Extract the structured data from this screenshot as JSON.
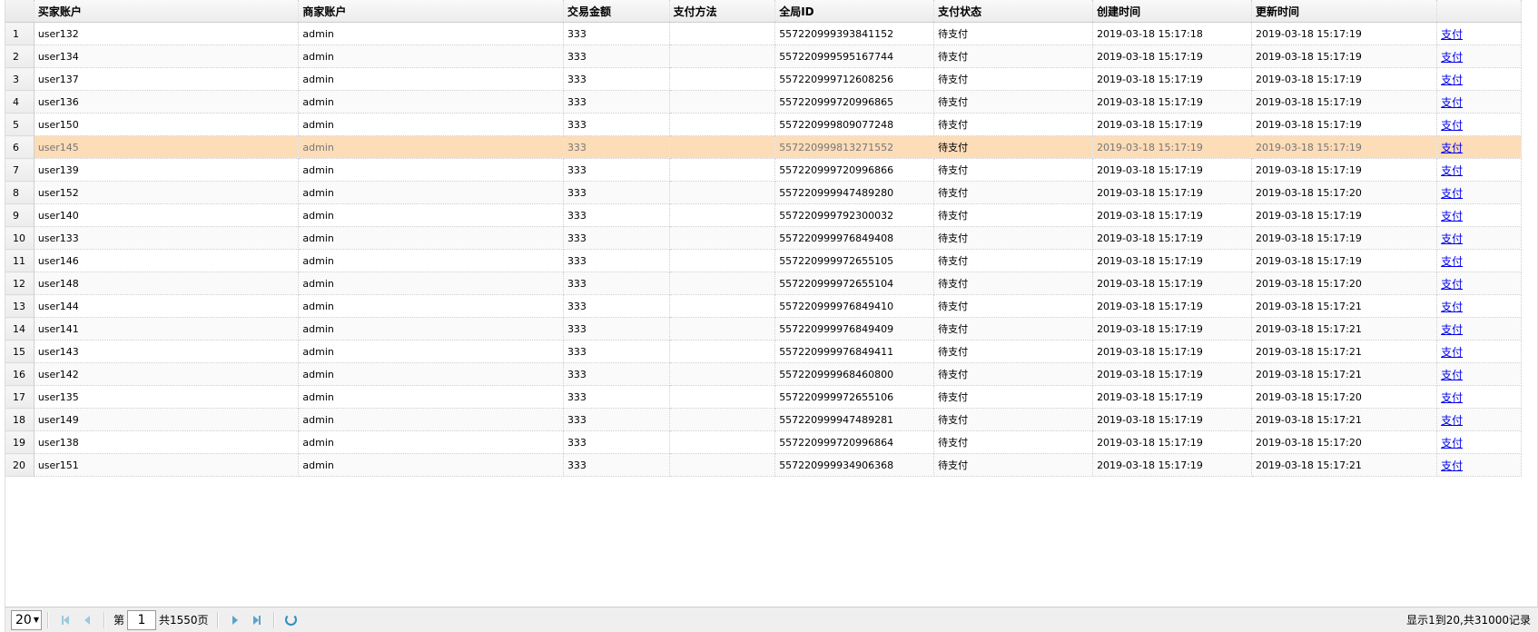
{
  "columns": [
    "买家账户",
    "商家账户",
    "交易金额",
    "支付方法",
    "全局ID",
    "支付状态",
    "创建时间",
    "更新时间",
    ""
  ],
  "rows": [
    {
      "n": "1",
      "buyer": "user132",
      "seller": "admin",
      "amount": "333",
      "method": "",
      "gid": "557220999393841152",
      "status": "待支付",
      "created": "2019-03-18  15:17:18",
      "updated": "2019-03-18  15:17:19",
      "action": "支付"
    },
    {
      "n": "2",
      "buyer": "user134",
      "seller": "admin",
      "amount": "333",
      "method": "",
      "gid": "557220999595167744",
      "status": "待支付",
      "created": "2019-03-18  15:17:19",
      "updated": "2019-03-18  15:17:19",
      "action": "支付"
    },
    {
      "n": "3",
      "buyer": "user137",
      "seller": "admin",
      "amount": "333",
      "method": "",
      "gid": "557220999712608256",
      "status": "待支付",
      "created": "2019-03-18  15:17:19",
      "updated": "2019-03-18  15:17:19",
      "action": "支付"
    },
    {
      "n": "4",
      "buyer": "user136",
      "seller": "admin",
      "amount": "333",
      "method": "",
      "gid": "557220999720996865",
      "status": "待支付",
      "created": "2019-03-18  15:17:19",
      "updated": "2019-03-18  15:17:19",
      "action": "支付"
    },
    {
      "n": "5",
      "buyer": "user150",
      "seller": "admin",
      "amount": "333",
      "method": "",
      "gid": "557220999809077248",
      "status": "待支付",
      "created": "2019-03-18  15:17:19",
      "updated": "2019-03-18  15:17:19",
      "action": "支付"
    },
    {
      "n": "6",
      "buyer": "user145",
      "seller": "admin",
      "amount": "333",
      "method": "",
      "gid": "557220999813271552",
      "status": "待支付",
      "created": "2019-03-18  15:17:19",
      "updated": "2019-03-18  15:17:19",
      "action": "支付",
      "selected": true
    },
    {
      "n": "7",
      "buyer": "user139",
      "seller": "admin",
      "amount": "333",
      "method": "",
      "gid": "557220999720996866",
      "status": "待支付",
      "created": "2019-03-18  15:17:19",
      "updated": "2019-03-18  15:17:19",
      "action": "支付"
    },
    {
      "n": "8",
      "buyer": "user152",
      "seller": "admin",
      "amount": "333",
      "method": "",
      "gid": "557220999947489280",
      "status": "待支付",
      "created": "2019-03-18  15:17:19",
      "updated": "2019-03-18  15:17:20",
      "action": "支付"
    },
    {
      "n": "9",
      "buyer": "user140",
      "seller": "admin",
      "amount": "333",
      "method": "",
      "gid": "557220999792300032",
      "status": "待支付",
      "created": "2019-03-18  15:17:19",
      "updated": "2019-03-18  15:17:19",
      "action": "支付"
    },
    {
      "n": "10",
      "buyer": "user133",
      "seller": "admin",
      "amount": "333",
      "method": "",
      "gid": "557220999976849408",
      "status": "待支付",
      "created": "2019-03-18  15:17:19",
      "updated": "2019-03-18  15:17:19",
      "action": "支付"
    },
    {
      "n": "11",
      "buyer": "user146",
      "seller": "admin",
      "amount": "333",
      "method": "",
      "gid": "557220999972655105",
      "status": "待支付",
      "created": "2019-03-18  15:17:19",
      "updated": "2019-03-18  15:17:19",
      "action": "支付"
    },
    {
      "n": "12",
      "buyer": "user148",
      "seller": "admin",
      "amount": "333",
      "method": "",
      "gid": "557220999972655104",
      "status": "待支付",
      "created": "2019-03-18  15:17:19",
      "updated": "2019-03-18  15:17:20",
      "action": "支付"
    },
    {
      "n": "13",
      "buyer": "user144",
      "seller": "admin",
      "amount": "333",
      "method": "",
      "gid": "557220999976849410",
      "status": "待支付",
      "created": "2019-03-18  15:17:19",
      "updated": "2019-03-18  15:17:21",
      "action": "支付"
    },
    {
      "n": "14",
      "buyer": "user141",
      "seller": "admin",
      "amount": "333",
      "method": "",
      "gid": "557220999976849409",
      "status": "待支付",
      "created": "2019-03-18  15:17:19",
      "updated": "2019-03-18  15:17:21",
      "action": "支付"
    },
    {
      "n": "15",
      "buyer": "user143",
      "seller": "admin",
      "amount": "333",
      "method": "",
      "gid": "557220999976849411",
      "status": "待支付",
      "created": "2019-03-18  15:17:19",
      "updated": "2019-03-18  15:17:21",
      "action": "支付"
    },
    {
      "n": "16",
      "buyer": "user142",
      "seller": "admin",
      "amount": "333",
      "method": "",
      "gid": "557220999968460800",
      "status": "待支付",
      "created": "2019-03-18  15:17:19",
      "updated": "2019-03-18  15:17:21",
      "action": "支付"
    },
    {
      "n": "17",
      "buyer": "user135",
      "seller": "admin",
      "amount": "333",
      "method": "",
      "gid": "557220999972655106",
      "status": "待支付",
      "created": "2019-03-18  15:17:19",
      "updated": "2019-03-18  15:17:20",
      "action": "支付"
    },
    {
      "n": "18",
      "buyer": "user149",
      "seller": "admin",
      "amount": "333",
      "method": "",
      "gid": "557220999947489281",
      "status": "待支付",
      "created": "2019-03-18  15:17:19",
      "updated": "2019-03-18  15:17:21",
      "action": "支付"
    },
    {
      "n": "19",
      "buyer": "user138",
      "seller": "admin",
      "amount": "333",
      "method": "",
      "gid": "557220999720996864",
      "status": "待支付",
      "created": "2019-03-18  15:17:19",
      "updated": "2019-03-18  15:17:20",
      "action": "支付"
    },
    {
      "n": "20",
      "buyer": "user151",
      "seller": "admin",
      "amount": "333",
      "method": "",
      "gid": "557220999934906368",
      "status": "待支付",
      "created": "2019-03-18  15:17:19",
      "updated": "2019-03-18  15:17:21",
      "action": "支付"
    }
  ],
  "pager": {
    "page_size": "20",
    "page_prefix": "第",
    "page_current": "1",
    "page_total": "共1550页",
    "info": "显示1到20,共31000记录"
  },
  "colors": {
    "selected_row": "#fddcb8",
    "link": "#0000ee",
    "pager_icon": "#5aa3c9"
  }
}
